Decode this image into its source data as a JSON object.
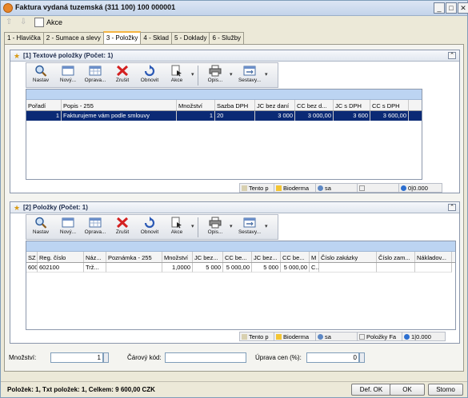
{
  "window": {
    "title": "Faktura vydaná tuzemská (311 100)  100 000001",
    "controls": [
      "_",
      "□",
      "✕"
    ]
  },
  "actionbar": {
    "akce_label": "Akce"
  },
  "tabs": [
    {
      "label": "1 - Hlavička"
    },
    {
      "label": "2 - Sumace a slevy"
    },
    {
      "label": "3 - Položky"
    },
    {
      "label": "4 - Sklad"
    },
    {
      "label": "5 - Doklady"
    },
    {
      "label": "6 - Služby"
    }
  ],
  "active_tab": 2,
  "toolbar": {
    "buttons": [
      {
        "label": "Nastav",
        "icon": "magnifier-icon"
      },
      {
        "label": "Nový...",
        "icon": "new-record-icon"
      },
      {
        "label": "Oprava...",
        "icon": "edit-grid-icon"
      },
      {
        "label": "Zrušit",
        "icon": "delete-x-icon"
      },
      {
        "label": "Obnovit",
        "icon": "refresh-icon"
      },
      {
        "label": "Akce",
        "icon": "actions-icon"
      }
    ],
    "buttons2": [
      {
        "label": "Opis...",
        "icon": "printer-icon"
      },
      {
        "label": "Sestavy...",
        "icon": "reports-icon"
      }
    ]
  },
  "section1": {
    "title": "[1] Textové položky  (Počet: 1)",
    "columns": [
      "Pořadí",
      "Popis - 255",
      "Množství",
      "Sazba DPH",
      "JC bez daní",
      "CC bez d...",
      "JC s DPH",
      "CC s DPH"
    ],
    "rows": [
      [
        "1",
        "Fakturujeme vám podle smlouvy",
        "1",
        "20",
        "3 000",
        "3 000,00",
        "3 600",
        "3 600,00"
      ]
    ],
    "status": {
      "item1": "Tento p",
      "item2": "Bioderma",
      "item3": "sa",
      "item4": "",
      "item5": "0|0.000"
    }
  },
  "section2": {
    "title": "[2] Položky  (Počet: 1)",
    "columns": [
      "SZ",
      "Reg. číslo",
      "Náz...",
      "Poznámka - 255",
      "Množství",
      "JC bez...",
      "CC be...",
      "JC bez...",
      "CC be...",
      "M",
      "Číslo zakázky",
      "Číslo zam...",
      "Nákladov..."
    ],
    "rows": [
      [
        "600",
        "602100",
        "Trž...",
        "",
        "1,0000",
        "5 000",
        "5 000,00",
        "5 000",
        "5 000,00",
        "C...",
        "",
        "",
        ""
      ]
    ],
    "status": {
      "item1": "Tento p",
      "item2": "Bioderma",
      "item3": "sa",
      "item4": "Položky Fa",
      "item5": "1|0.000"
    }
  },
  "inputs": {
    "mnozstvi_label": "Množství:",
    "mnozstvi_value": "1",
    "carovy_label": "Čárový kód:",
    "carovy_value": "",
    "uprava_label": "Úprava cen (%):",
    "uprava_value": "0"
  },
  "bottom": {
    "summary": "Položek: 1,  Txt položek: 1,  Celkem: 9 600,00 CZK",
    "def_ok": "Def. OK",
    "ok": "OK",
    "storno": "Storno"
  },
  "colors": {
    "selected_row": "#0b2a75",
    "filter_row": "#bcd4f2",
    "active_tab_accent": "#f5b441"
  }
}
